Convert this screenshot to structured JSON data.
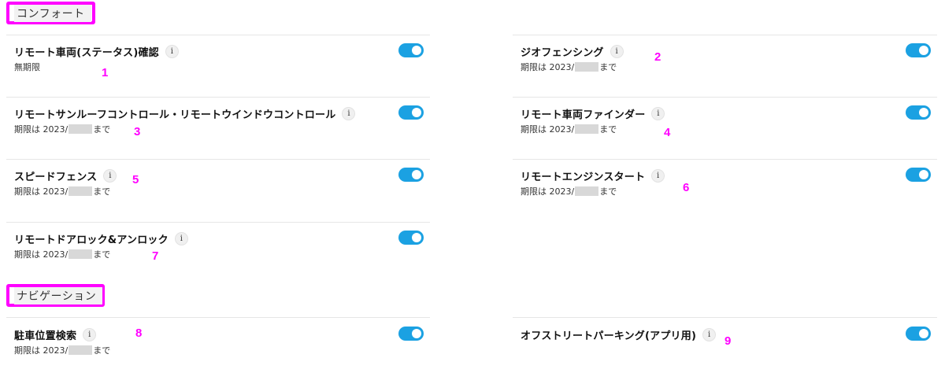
{
  "sections": {
    "comfort": {
      "label": "コンフォート"
    },
    "navigation": {
      "label": "ナビゲーション"
    }
  },
  "features": [
    {
      "title": "リモート車両(ステータス)確認",
      "expiry": "無期限",
      "toggle_on": true
    },
    {
      "title": "ジオフェンシング",
      "expiry_prefix": "期限は 2023/",
      "expiry_suffix": "まで",
      "toggle_on": true
    },
    {
      "title": "リモートサンルーフコントロール・リモートウインドウコントロール",
      "expiry_prefix": "期限は 2023/",
      "expiry_suffix": "まで",
      "toggle_on": true
    },
    {
      "title": "リモート車両ファインダー",
      "expiry_prefix": "期限は 2023/",
      "expiry_suffix": "まで",
      "toggle_on": true
    },
    {
      "title": "スピードフェンス",
      "expiry_prefix": "期限は 2023/",
      "expiry_suffix": "まで",
      "toggle_on": true
    },
    {
      "title": "リモートエンジンスタート",
      "expiry_prefix": "期限は 2023/",
      "expiry_suffix": "まで",
      "toggle_on": true
    },
    {
      "title": "リモートドアロック&アンロック",
      "expiry_prefix": "期限は 2023/",
      "expiry_suffix": "まで",
      "toggle_on": true
    },
    {
      "title": "駐車位置検索",
      "expiry_prefix": "期限は 2023/",
      "expiry_suffix": "まで",
      "toggle_on": true
    },
    {
      "title": "オフストリートパーキング(アプリ用)",
      "toggle_on": true
    }
  ],
  "info_icon_glyph": "i",
  "annotations": [
    "1",
    "2",
    "3",
    "4",
    "5",
    "6",
    "7",
    "8",
    "9"
  ],
  "colors": {
    "toggle_on": "#1ba1e2",
    "annotation": "#ff00ff",
    "separator": "#e6e6e6"
  }
}
